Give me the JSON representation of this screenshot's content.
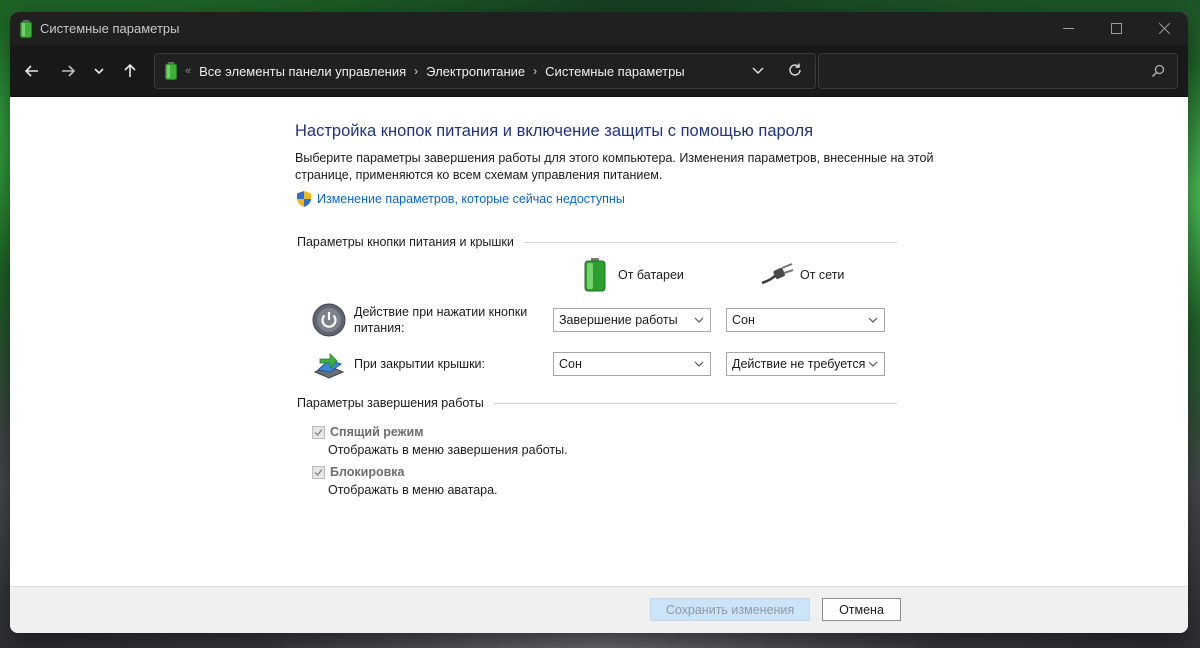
{
  "window": {
    "title": "Системные параметры",
    "controls": {
      "minimize": "—",
      "maximize": "☐",
      "close": "✕"
    }
  },
  "nav": {
    "breadcrumbs": [
      "Все элементы панели управления",
      "Электропитание",
      "Системные параметры"
    ],
    "breadcrumb_overflow": "«",
    "breadcrumb_separator": "›",
    "search_placeholder": ""
  },
  "main": {
    "heading": "Настройка кнопок питания и включение защиты с помощью пароля",
    "description": "Выберите параметры завершения работы для этого компьютера. Изменения параметров, внесенные на этой странице, применяются ко всем схемам управления питанием.",
    "uac_link": "Изменение параметров, которые сейчас недоступны",
    "power_section": {
      "title": "Параметры кнопки питания и крышки",
      "columns": {
        "battery": "От батареи",
        "plugged": "От сети"
      },
      "rows": [
        {
          "label": "Действие при нажатии кнопки питания:",
          "battery_value": "Завершение работы",
          "plugged_value": "Сон"
        },
        {
          "label": "При закрытии крышки:",
          "battery_value": "Сон",
          "plugged_value": "Действие не требуется"
        }
      ]
    },
    "shutdown_section": {
      "title": "Параметры завершения работы",
      "items": [
        {
          "label": "Спящий режим",
          "description": "Отображать в меню завершения работы.",
          "checked": true,
          "enabled": false
        },
        {
          "label": "Блокировка",
          "description": "Отображать в меню аватара.",
          "checked": true,
          "enabled": false
        }
      ]
    }
  },
  "footer": {
    "save_label": "Сохранить изменения",
    "cancel_label": "Отмена"
  },
  "colors": {
    "heading": "#1e3287",
    "link": "#0a66c2",
    "titlebar": "#202020",
    "navbar": "#191919"
  }
}
